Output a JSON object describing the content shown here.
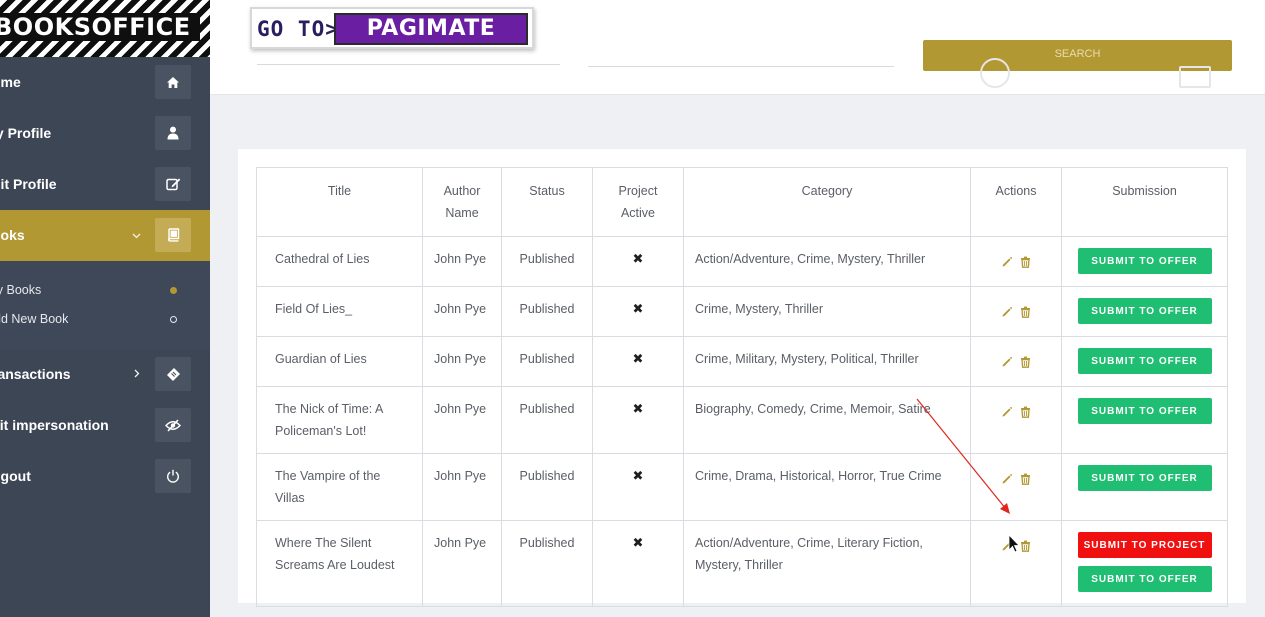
{
  "sidebar": {
    "logo": "BOOKSOFFICE",
    "items": [
      {
        "label": "ome",
        "icon": "home-icon"
      },
      {
        "label": "ly Profile",
        "icon": "user-icon"
      },
      {
        "label": "dit Profile",
        "icon": "edit-icon"
      },
      {
        "label": "ooks",
        "icon": "book-icon"
      },
      {
        "label": "ransactions",
        "icon": "ticket-icon"
      },
      {
        "label": "xit impersonation",
        "icon": "eye-slash-icon"
      },
      {
        "label": "ogout",
        "icon": "power-icon"
      }
    ],
    "submenu": [
      {
        "label": "ly Books",
        "state": "active"
      },
      {
        "label": "dd New Book",
        "state": "inactive"
      }
    ]
  },
  "topbar": {
    "search_label": "SEARCH"
  },
  "promo": {
    "prefix": "GO TO>",
    "brand": "PAGIMATE"
  },
  "table": {
    "headers": {
      "title": "Title",
      "author": "Author Name",
      "status": "Status",
      "active": "Project Active",
      "category": "Category",
      "actions": "Actions",
      "submission": "Submission"
    },
    "rows": [
      {
        "title": "Cathedral of Lies",
        "author": "John Pye",
        "status": "Published",
        "active": "✖",
        "category": "Action/Adventure, Crime, Mystery, Thriller"
      },
      {
        "title": "Field Of Lies_",
        "author": "John Pye",
        "status": "Published",
        "active": "✖",
        "category": "Crime, Mystery, Thriller"
      },
      {
        "title": "Guardian of Lies",
        "author": "John Pye",
        "status": "Published",
        "active": "✖",
        "category": "Crime, Military, Mystery, Political, Thriller"
      },
      {
        "title": "The Nick of Time: A Policeman's Lot!",
        "author": "John Pye",
        "status": "Published",
        "active": "✖",
        "category": "Biography, Comedy, Crime, Memoir, Satire"
      },
      {
        "title": "The Vampire of the Villas",
        "author": "John Pye",
        "status": "Published",
        "active": "✖",
        "category": "Crime, Drama, Historical, Horror, True Crime"
      },
      {
        "title": "Where The Silent Screams Are Loudest",
        "author": "John Pye",
        "status": "Published",
        "active": "✖",
        "category": "Action/Adventure, Crime, Literary Fiction, Mystery, Thriller"
      }
    ],
    "offer_label": "SUBMIT TO OFFER",
    "project_label": "SUBMIT TO PROJECT"
  },
  "colors": {
    "sidebar_bg": "#3d4655",
    "accent_gold": "#b29833",
    "offer_green": "#1fbe72",
    "project_red": "#f01010",
    "annotation_arrow": "#e0271f"
  }
}
